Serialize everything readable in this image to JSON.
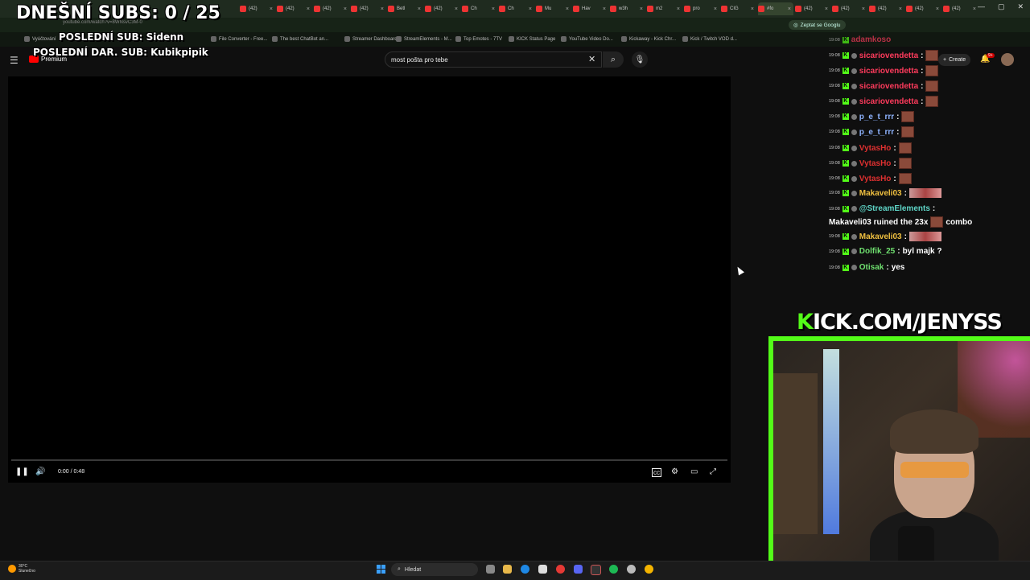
{
  "overlay": {
    "subs_goal": "DNEŠNÍ SUBS: 0 / 25",
    "last_sub": "POSLEDNÍ SUB: Sidenn",
    "last_donation_sub": "POSLEDNÍ DAR. SUB: Kubikpipik"
  },
  "browser": {
    "tabs": [
      "(42)",
      "(42)",
      "(42)",
      "(42)",
      "Betl",
      "(42)",
      "Ch",
      "Ch",
      "Mu",
      "Hav",
      "w3h",
      "m2",
      "pro",
      "CIG",
      "#fo",
      "(42)",
      "(42)",
      "(42)",
      "(42)",
      "(42)"
    ],
    "url": "youtube.com/watch?v=8WNsvC3M-0",
    "ask_google": "Zeptat se Googlu",
    "bookmarks": [
      "Vyúčtování",
      "File Converter - Free...",
      "The best ChatBot an...",
      "Streamer Dashboard",
      "StreamElements - M...",
      "Top Emotes - 7TV",
      "KICK Status Page",
      "YouTube Video Do...",
      "Kickaway - Kick Chr...",
      "Kick / Twitch VOD d..."
    ]
  },
  "youtube": {
    "logo_text": "Premium",
    "search_value": "most pošta pro tebe",
    "create_label": "Create",
    "notification_count": "9+",
    "time_display": "0:00 / 0:48"
  },
  "chat": {
    "partial_top": "adamkoso",
    "messages": [
      {
        "time": "19:08",
        "user": "sicariovendetta",
        "color": "#ff3b5c",
        "text": "",
        "emote": "small"
      },
      {
        "time": "19:08",
        "user": "sicariovendetta",
        "color": "#ff3b5c",
        "text": "",
        "emote": "small"
      },
      {
        "time": "19:08",
        "user": "sicariovendetta",
        "color": "#ff3b5c",
        "text": "",
        "emote": "small"
      },
      {
        "time": "19:08",
        "user": "sicariovendetta",
        "color": "#ff3b5c",
        "text": "",
        "emote": "small"
      },
      {
        "time": "19:08",
        "user": "p_e_t_rrr",
        "color": "#8fb4ff",
        "text": "",
        "emote": "small"
      },
      {
        "time": "19:08",
        "user": "p_e_t_rrr",
        "color": "#8fb4ff",
        "text": "",
        "emote": "small"
      },
      {
        "time": "19:08",
        "user": "VytasHo",
        "color": "#e03030",
        "text": "",
        "emote": "small"
      },
      {
        "time": "19:08",
        "user": "VytasHo",
        "color": "#e03030",
        "text": "",
        "emote": "small"
      },
      {
        "time": "19:08",
        "user": "VytasHo",
        "color": "#e03030",
        "text": "",
        "emote": "small"
      },
      {
        "time": "19:08",
        "user": "Makaveli03",
        "color": "#f0c040",
        "text": "",
        "emote": "wide"
      },
      {
        "time": "19:08",
        "user": "@StreamElements",
        "color": "#5fd6c8",
        "text": "",
        "emote": "none"
      },
      {
        "time": "19:08",
        "user": "Makaveli03",
        "color": "#f0c040",
        "text": "",
        "emote": "wide"
      },
      {
        "time": "19:08",
        "user": "Dolfik_25",
        "color": "#6fe06f",
        "text": "byl majk ?",
        "emote": "none"
      },
      {
        "time": "19:08",
        "user": "Otisak",
        "color": "#6fe06f",
        "text": "yes",
        "emote": "none"
      }
    ],
    "se_continuation": "Makaveli03 ruined the 23x",
    "se_suffix": "combo"
  },
  "brand": {
    "kick_k": "K",
    "kick_rest": "ICK.COM/JENYSS"
  },
  "taskbar": {
    "temperature": "30°C",
    "weather": "Slunečno",
    "search_label": "Hledat"
  }
}
